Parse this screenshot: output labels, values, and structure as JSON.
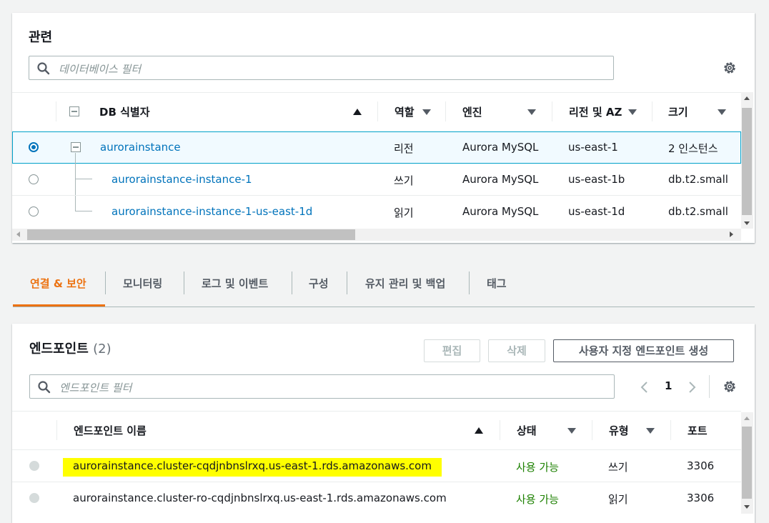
{
  "related": {
    "title": "관련",
    "filter_placeholder": "데이터베이스 필터",
    "columns": {
      "db_id": "DB 식별자",
      "role": "역할",
      "engine": "엔진",
      "region": "리전 및 AZ",
      "size": "크기"
    },
    "rows": [
      {
        "id": "aurorainstance",
        "role": "리전",
        "engine": "Aurora MySQL",
        "region": "us-east-1",
        "size": "2 인스턴스"
      },
      {
        "id": "aurorainstance-instance-1",
        "role": "쓰기",
        "engine": "Aurora MySQL",
        "region": "us-east-1b",
        "size": "db.t2.small"
      },
      {
        "id": "aurorainstance-instance-1-us-east-1d",
        "role": "읽기",
        "engine": "Aurora MySQL",
        "region": "us-east-1d",
        "size": "db.t2.small"
      }
    ]
  },
  "tabs": [
    "연결 & 보안",
    "모니터링",
    "로그 및 이벤트",
    "구성",
    "유지 관리 및 백업",
    "태그"
  ],
  "endpoints": {
    "title": "엔드포인트",
    "count": "(2)",
    "edit_label": "편집",
    "delete_label": "삭제",
    "create_label": "사용자 지정 엔드포인트 생성",
    "filter_placeholder": "엔드포인트 필터",
    "page": "1",
    "columns": {
      "name": "엔드포인트 이름",
      "status": "상태",
      "type": "유형",
      "port": "포트"
    },
    "rows": [
      {
        "name": "aurorainstance.cluster-cqdjnbnslrxq.us-east-1.rds.amazonaws.com",
        "status": "사용 가능",
        "type": "쓰기",
        "port": "3306"
      },
      {
        "name": "aurorainstance.cluster-ro-cqdjnbnslrxq.us-east-1.rds.amazonaws.com",
        "status": "사용 가능",
        "type": "읽기",
        "port": "3306"
      }
    ]
  },
  "colors": {
    "accent": "#ec7211",
    "link": "#0073bb",
    "available": "#1d8102",
    "highlight": "#ffff00"
  }
}
